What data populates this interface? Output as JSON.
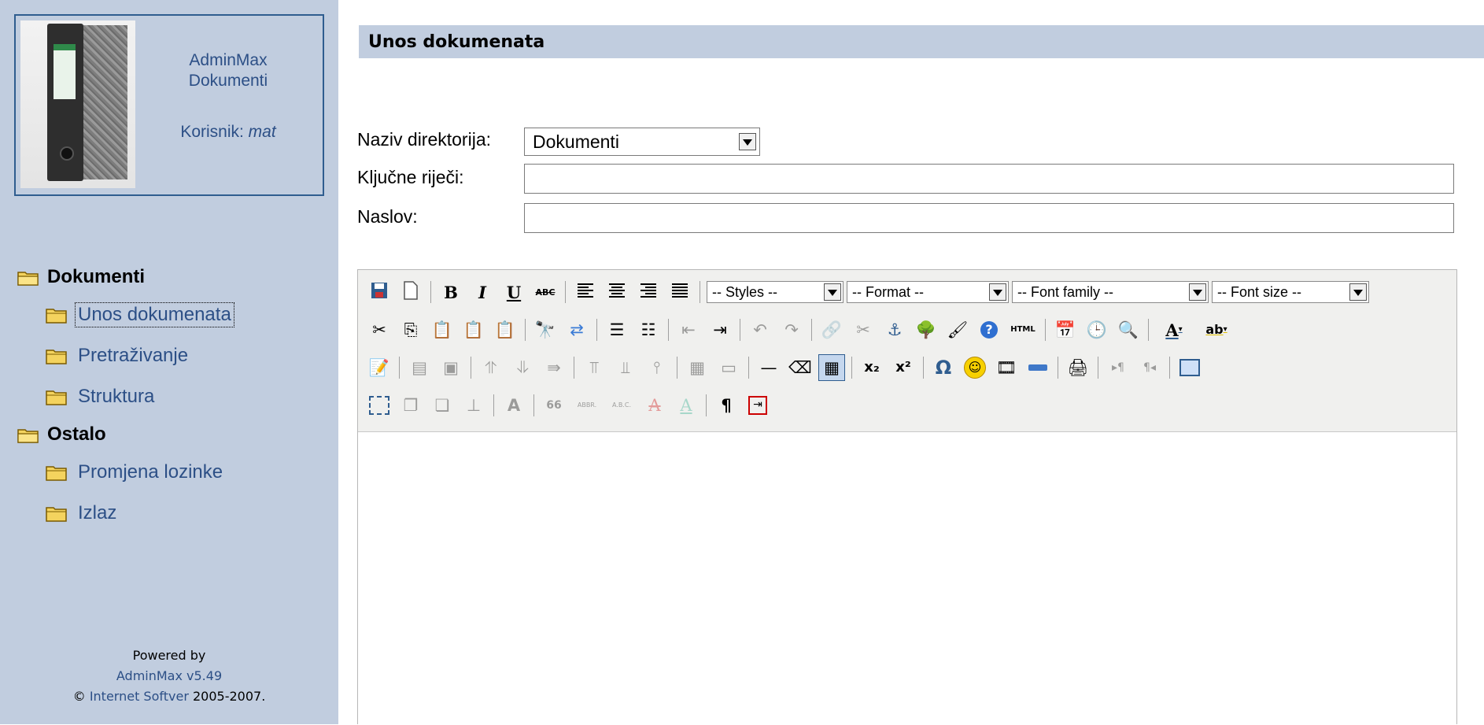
{
  "brand": {
    "app_name": "AdminMax",
    "module": "Dokumenti",
    "user_label": "Korisnik: ",
    "user_name": "mat"
  },
  "nav": {
    "groups": [
      {
        "label": "Dokumenti",
        "items": [
          "Unos dokumenata",
          "Pretraživanje",
          "Struktura"
        ]
      },
      {
        "label": "Ostalo",
        "items": [
          "Promjena lozinke",
          "Izlaz"
        ]
      }
    ]
  },
  "footer": {
    "powered": "Powered by",
    "version": "AdminMax v5.49",
    "copyright_symbol": "©",
    "company": "Internet Softver",
    "years": "2005-2007."
  },
  "page": {
    "title": "Unos dokumenata"
  },
  "form": {
    "directory_label": "Naziv direktorija:",
    "directory_value": "Dokumenti",
    "keywords_label": "Ključne riječi:",
    "keywords_value": "",
    "title_label": "Naslov:",
    "title_value": ""
  },
  "editor": {
    "styles": "-- Styles --",
    "format": "-- Format --",
    "font_family": "-- Font family --",
    "font_size": "-- Font size --",
    "bold": "B",
    "italic": "I",
    "underline": "U",
    "strike": "ABC",
    "subscript": "x₂",
    "superscript": "x²",
    "omega": "Ω",
    "pilcrow": "¶",
    "html": "HTML",
    "abbr": "ABBR.",
    "acronym": "A.B.C.",
    "quote": "66"
  },
  "colors": {
    "sidebar": "#c1cddf",
    "link": "#2c4f86",
    "border": "#2f5d8f",
    "toolbar": "#f0f0ee"
  }
}
